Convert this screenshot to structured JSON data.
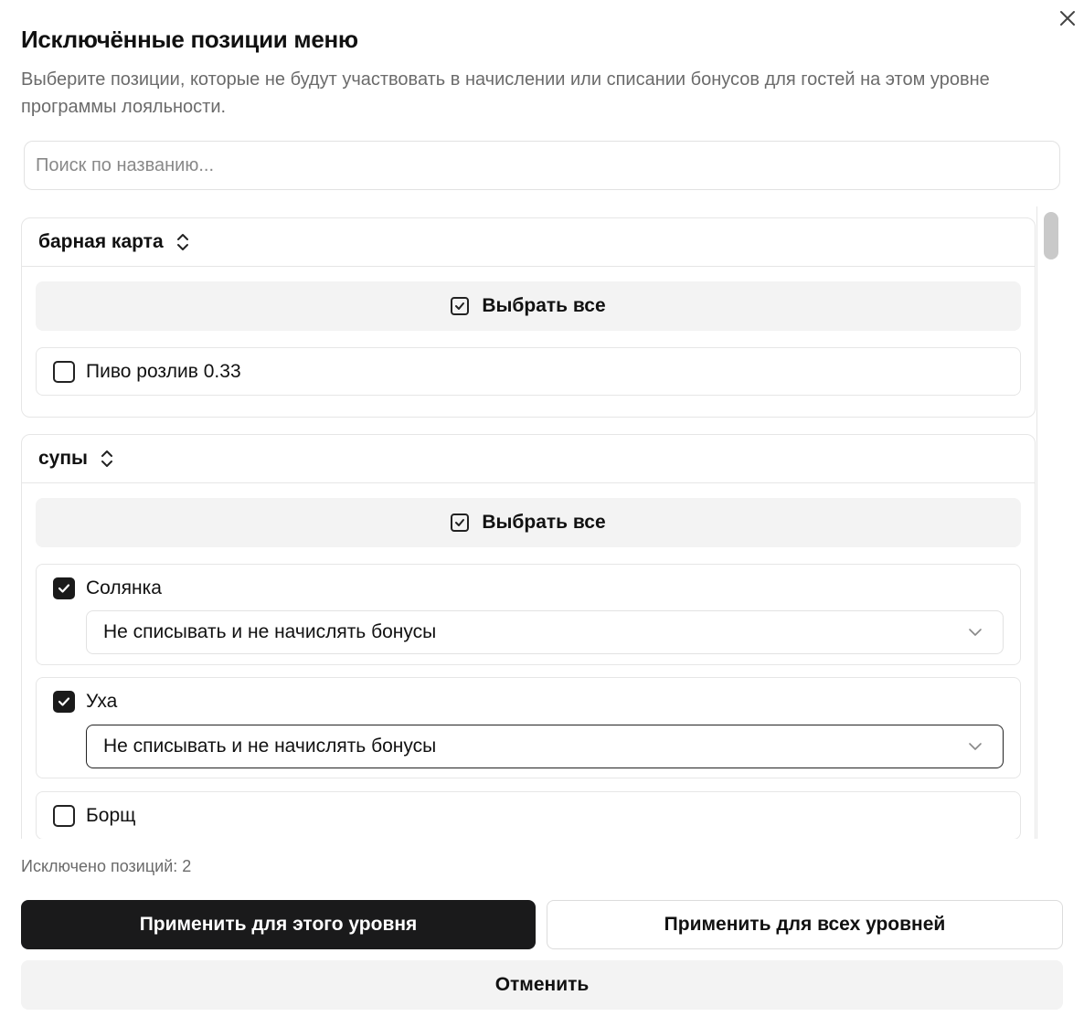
{
  "dialog": {
    "title": "Исключённые позиции меню",
    "subtitle": "Выберите позиции, которые не будут участвовать в начислении или списании бонусов для гостей на этом уровне программы лояльности.",
    "close_icon": "close-icon"
  },
  "search": {
    "placeholder": "Поиск по названию...",
    "value": ""
  },
  "categories": [
    {
      "name": "барная карта",
      "toggle_icon": "chevron-up-down-icon",
      "select_all_label": "Выбрать все",
      "items": [
        {
          "label": "Пиво розлив 0.33",
          "checked": false
        }
      ]
    },
    {
      "name": "супы",
      "toggle_icon": "chevron-up-down-icon",
      "select_all_label": "Выбрать все",
      "items": [
        {
          "label": "Солянка",
          "checked": true,
          "rule": "Не списывать и не начислять бонусы"
        },
        {
          "label": "Уха",
          "checked": true,
          "rule": "Не списывать и не начислять бонусы"
        },
        {
          "label": "Борщ",
          "checked": false
        }
      ]
    }
  ],
  "footer": {
    "excluded_count": "Исключено позиций: 2",
    "apply_level_label": "Применить для этого уровня",
    "apply_all_label": "Применить для всех уровней",
    "cancel_label": "Отменить"
  },
  "colors": {
    "primary": "#1a1a1b",
    "muted_text": "#6b6b6b",
    "border": "#e6e6e6",
    "surface": "#f3f3f3"
  }
}
